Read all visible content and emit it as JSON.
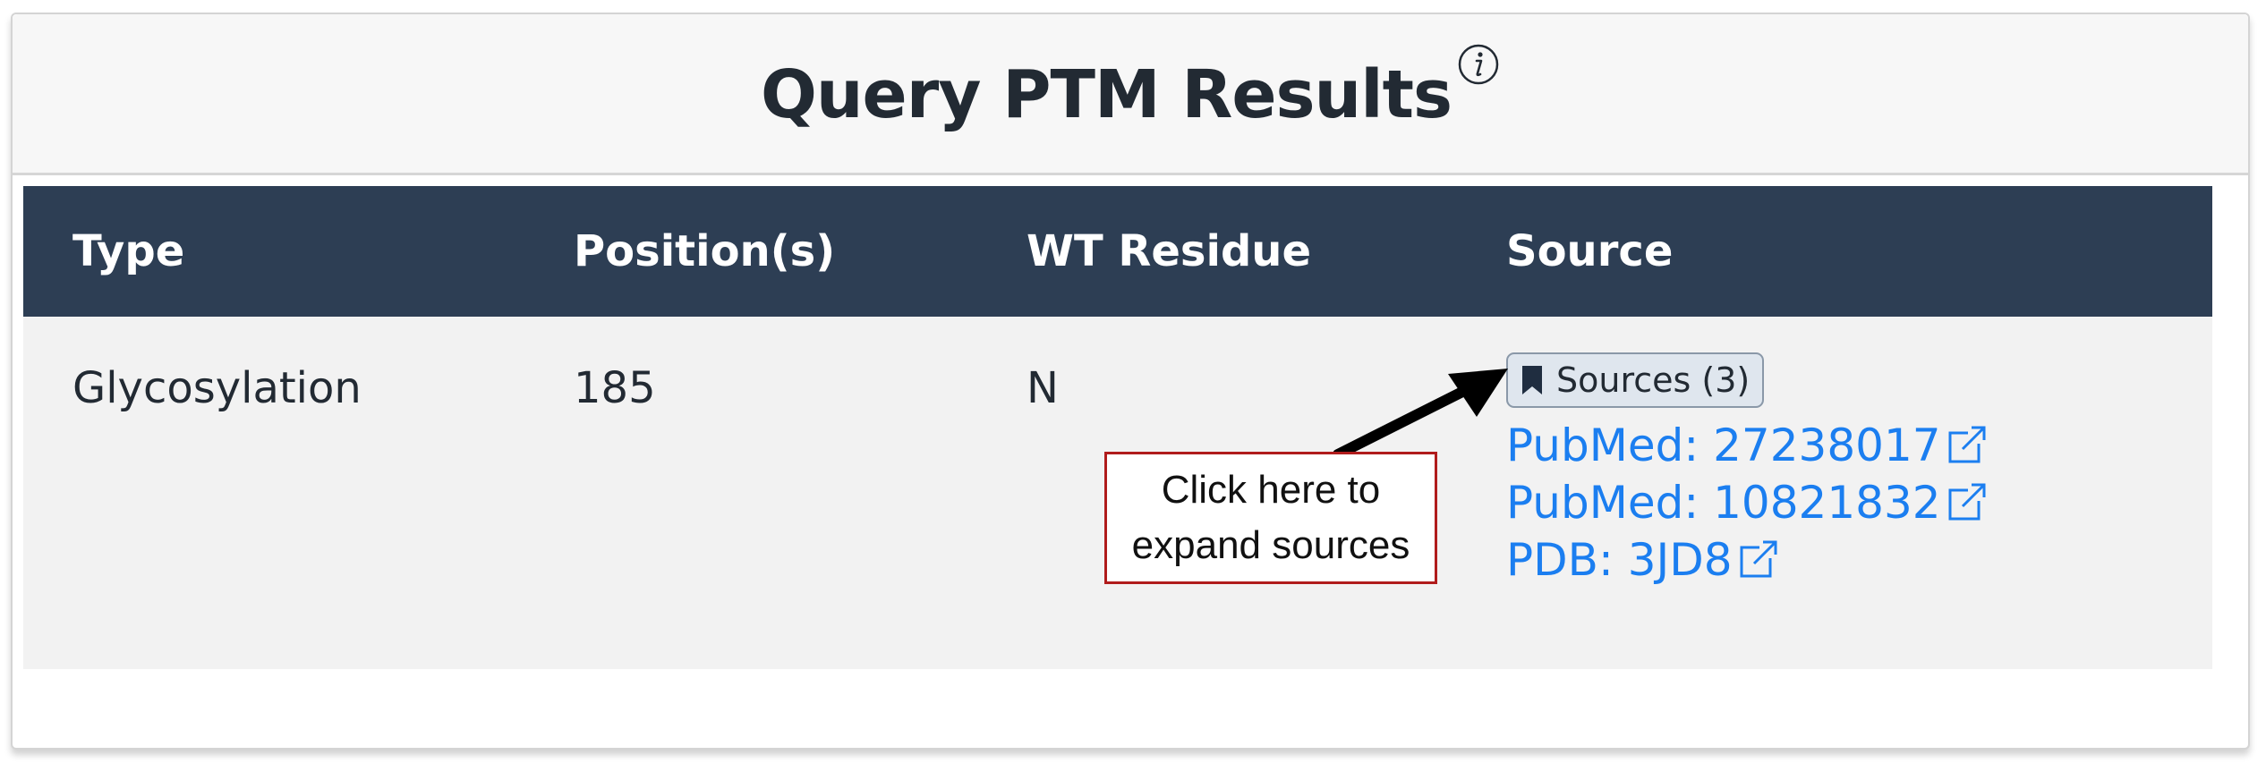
{
  "header": {
    "title": "Query PTM Results",
    "info_icon": "info-icon"
  },
  "table": {
    "columns": [
      "Type",
      "Position(s)",
      "WT Residue",
      "Source"
    ],
    "rows": [
      {
        "type": "Glycosylation",
        "positions": "185",
        "wt_residue": "N",
        "sources_button": {
          "label": "Sources (3)",
          "icon": "bookmark-icon"
        },
        "links": [
          {
            "label": "PubMed: 27238017",
            "icon": "external-link-icon"
          },
          {
            "label": "PubMed: 10821832",
            "icon": "external-link-icon"
          },
          {
            "label": "PDB: 3JD8",
            "icon": "external-link-icon"
          }
        ]
      }
    ]
  },
  "annotation": {
    "line1": "Click here to",
    "line2": "expand sources",
    "border_color": "#b01c1c"
  },
  "colors": {
    "table_header_bg": "#2d3e54",
    "table_body_bg": "#f2f2f2",
    "link": "#1b7ef0"
  }
}
